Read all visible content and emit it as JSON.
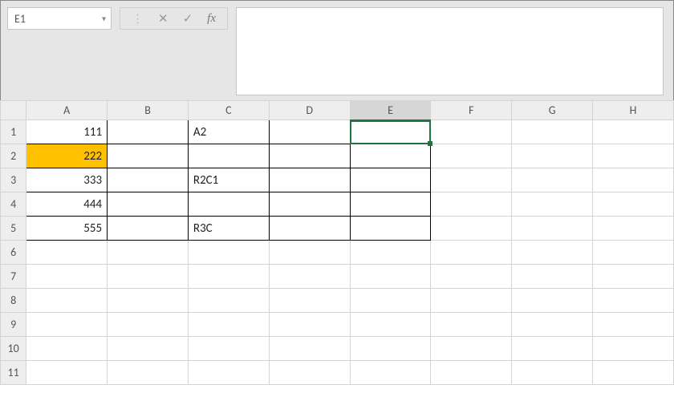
{
  "name_box": "E1",
  "formula_bar": "",
  "fx_label": "fx",
  "columns": [
    "A",
    "B",
    "C",
    "D",
    "E",
    "F",
    "G",
    "H"
  ],
  "rows": [
    "1",
    "2",
    "3",
    "4",
    "5",
    "6",
    "7",
    "8",
    "9",
    "10",
    "11"
  ],
  "selected_cell": "E1",
  "cells": {
    "A1": "111",
    "A2": "222",
    "A3": "333",
    "A4": "444",
    "A5": "555",
    "C1": "A2",
    "C3": "R2C1",
    "C5": "R3C"
  },
  "highlighted_cells": [
    "A2"
  ],
  "numeric_columns": [
    "A"
  ],
  "bordered_range": {
    "rows": [
      1,
      5
    ],
    "cols": [
      "A",
      "E"
    ]
  },
  "colors": {
    "select": "#217346",
    "highlight": "#ffc000"
  }
}
